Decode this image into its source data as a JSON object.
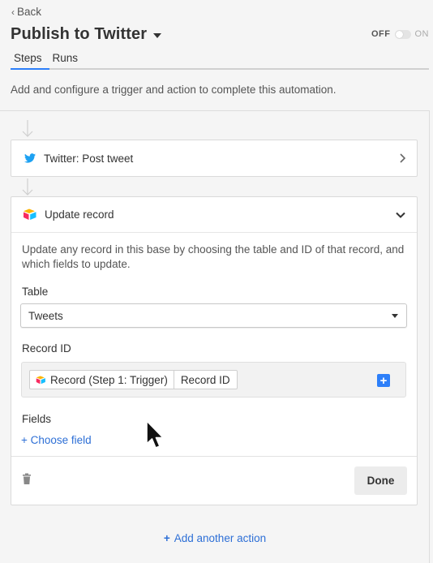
{
  "nav": {
    "back_label": "Back"
  },
  "header": {
    "title": "Publish to Twitter"
  },
  "toggle": {
    "off_label": "OFF",
    "on_label": "ON",
    "state": "off"
  },
  "tabs": [
    {
      "label": "Steps",
      "active": true
    },
    {
      "label": "Runs",
      "active": false
    }
  ],
  "intro_text": "Add and configure a trigger and action to complete this automation.",
  "steps": {
    "trigger": {
      "label": "Twitter: Post tweet",
      "icon": "twitter-icon"
    },
    "action": {
      "label": "Update record",
      "icon": "airtable-logo-icon",
      "description": "Update any record in this base by choosing the table and ID of that record, and which fields to update.",
      "table_label": "Table",
      "table_value": "Tweets",
      "record_id_label": "Record ID",
      "token_1": "Record (Step 1: Trigger)",
      "token_2": "Record ID",
      "fields_label": "Fields",
      "choose_field": "+ Choose field",
      "done_label": "Done"
    }
  },
  "add_action_label": "Add another action",
  "colors": {
    "accent": "#2d7ff9",
    "link": "#2d6fd6",
    "twitter": "#1da1f2"
  }
}
